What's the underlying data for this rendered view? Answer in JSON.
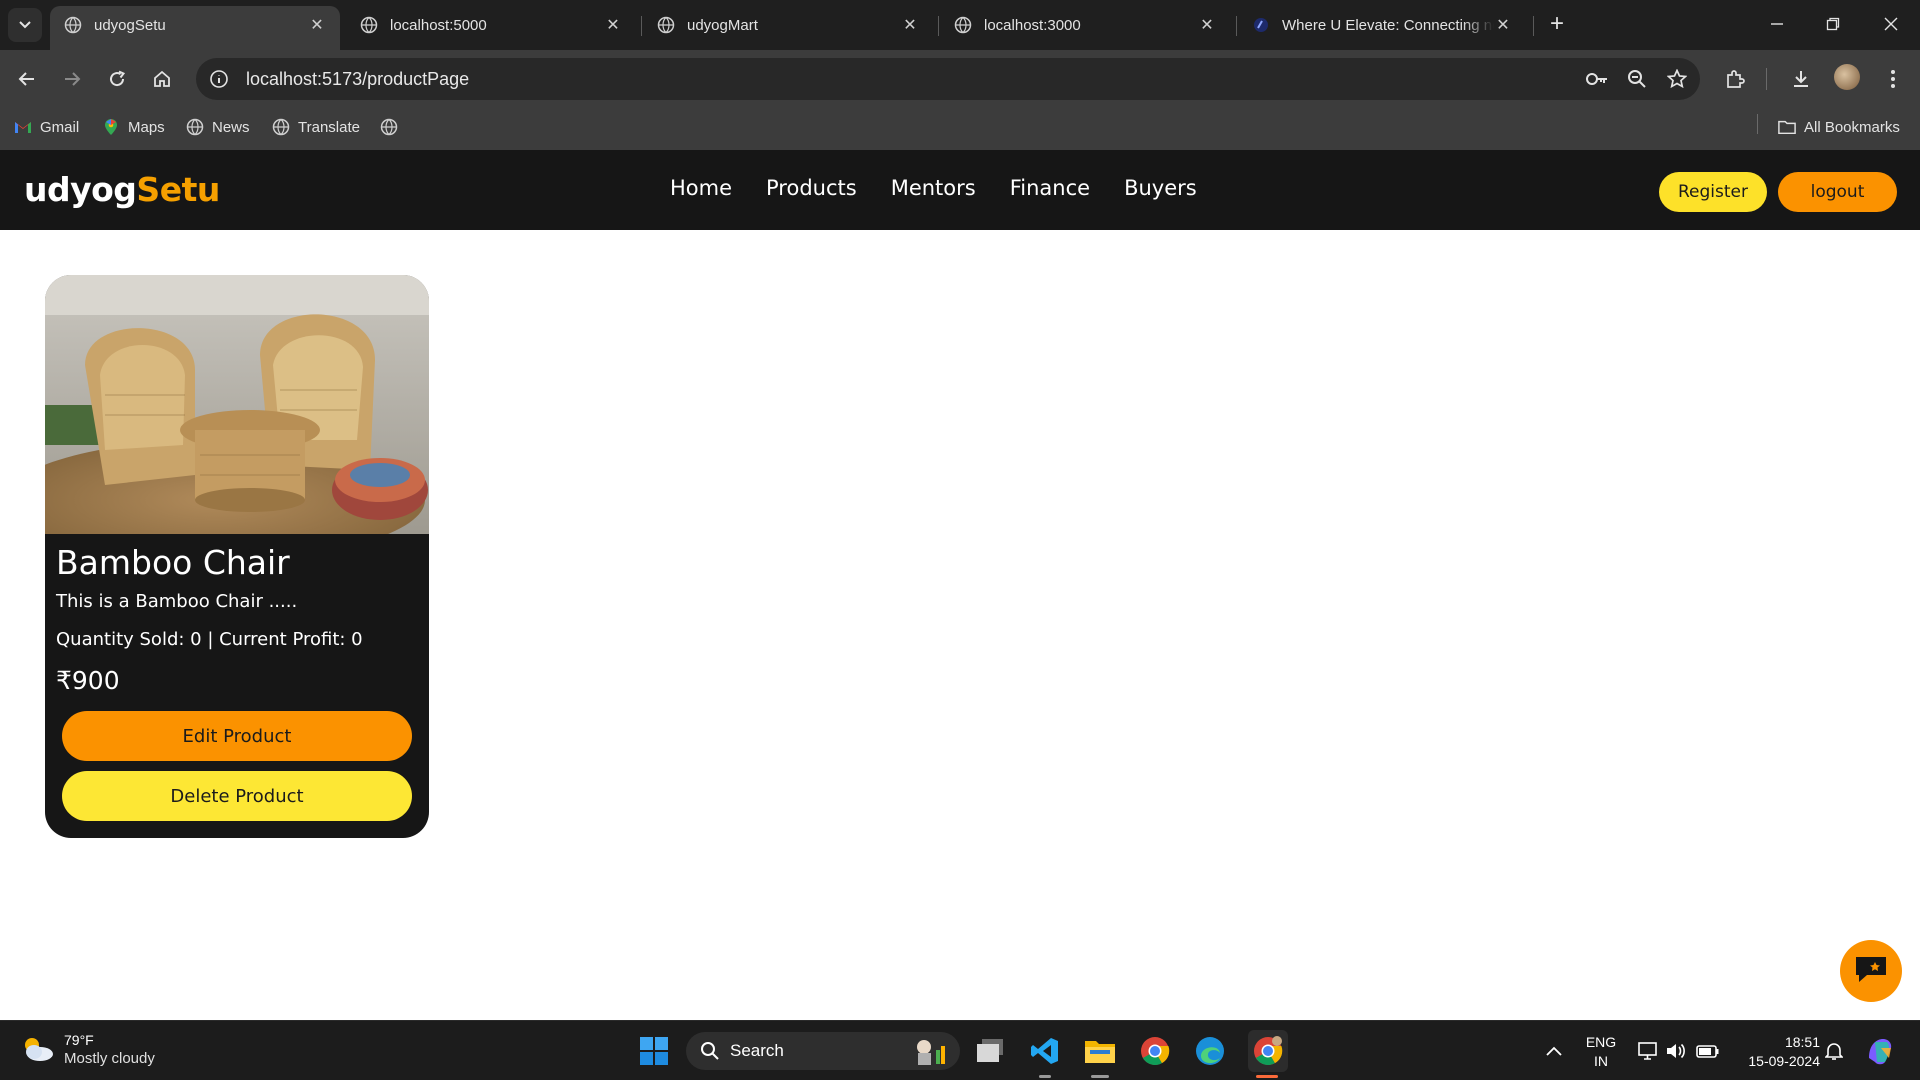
{
  "browser": {
    "tabs": [
      {
        "title": "udyogSetu",
        "active": true
      },
      {
        "title": "localhost:5000"
      },
      {
        "title": "udyogMart"
      },
      {
        "title": "localhost:3000"
      },
      {
        "title": "Where U Elevate: Connecting ne"
      }
    ],
    "url": "localhost:5173/productPage",
    "bookmarks": [
      "Gmail",
      "Maps",
      "News",
      "Translate"
    ],
    "all_bookmarks_label": "All Bookmarks"
  },
  "site": {
    "logo_part1": "udyog",
    "logo_part2": "Setu",
    "nav": [
      "Home",
      "Products",
      "Mentors",
      "Finance",
      "Buyers"
    ],
    "register_label": "Register",
    "logout_label": "logout"
  },
  "product": {
    "title": "Bamboo Chair",
    "description": "This is a Bamboo Chair .....",
    "stats": "Quantity Sold: 0 | Current Profit: 0",
    "price": "₹900",
    "edit_label": "Edit Product",
    "delete_label": "Delete Product"
  },
  "taskbar": {
    "temperature": "79°F",
    "weather": "Mostly cloudy",
    "search_label": "Search",
    "lang_line1": "ENG",
    "lang_line2": "IN",
    "time": "18:51",
    "date": "15-09-2024"
  },
  "colors": {
    "accent_orange": "#fb9200",
    "accent_yellow": "#fde129",
    "header_bg": "#161616"
  }
}
